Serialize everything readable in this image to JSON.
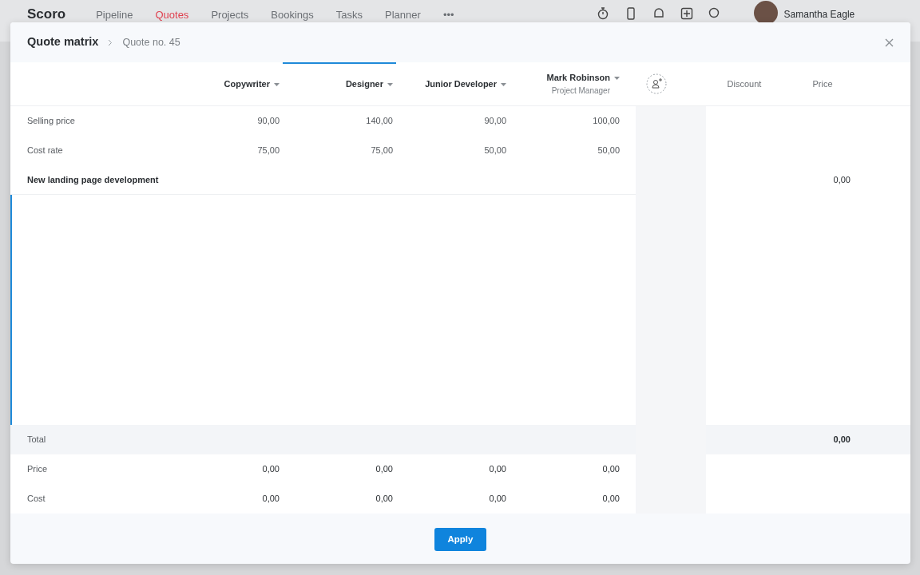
{
  "app_nav": {
    "logo": "Scoro",
    "items": [
      {
        "label": "Pipeline",
        "selected": false
      },
      {
        "label": "Quotes",
        "selected": true
      },
      {
        "label": "Projects",
        "selected": false
      },
      {
        "label": "Bookings",
        "selected": false
      },
      {
        "label": "Tasks",
        "selected": false
      },
      {
        "label": "Planner",
        "selected": false
      }
    ],
    "more": "•••",
    "user": "Samantha Eagle"
  },
  "header": {
    "title": "Quote matrix",
    "breadcrumb": "Quote no. 45"
  },
  "columns": [
    {
      "name": "Copywriter",
      "selected": false
    },
    {
      "name": "Designer",
      "selected": true
    },
    {
      "name": "Junior Developer",
      "selected": false
    },
    {
      "name": "Mark Robinson",
      "subtitle": "Project Manager",
      "selected": false
    }
  ],
  "extra_columns": [
    "Discount",
    "Price"
  ],
  "rate_rows": [
    {
      "label": "Selling price",
      "values": [
        "90,00",
        "140,00",
        "90,00",
        "100,00"
      ]
    },
    {
      "label": "Cost rate",
      "values": [
        "75,00",
        "75,00",
        "50,00",
        "50,00"
      ]
    }
  ],
  "tasks": [
    {
      "name": "New landing page development",
      "price": "0,00",
      "selected": true
    }
  ],
  "total": {
    "label": "Total",
    "price": "0,00"
  },
  "summary_rows": [
    {
      "label": "Price",
      "values": [
        "0,00",
        "0,00",
        "0,00",
        "0,00"
      ]
    },
    {
      "label": "Cost",
      "values": [
        "0,00",
        "0,00",
        "0,00",
        "0,00"
      ]
    }
  ],
  "apply_button": "Apply"
}
